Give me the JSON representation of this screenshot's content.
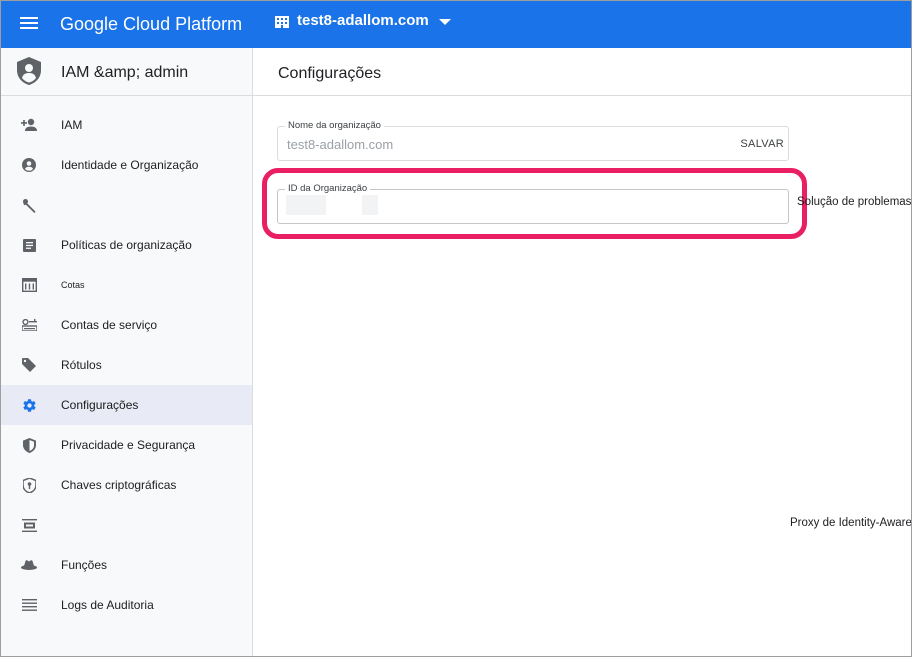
{
  "topbar": {
    "brand": "Google Cloud Platform",
    "project_name": "test8-adallom.com",
    "color": "#1a73e8"
  },
  "sidebar": {
    "title": "IAM &amp; admin",
    "items": [
      {
        "label": "IAM",
        "icon": "person-add-icon"
      },
      {
        "label": "Identidade e Organização",
        "icon": "account-circle-icon"
      },
      {
        "label": "",
        "icon": "wrench-icon"
      },
      {
        "label": "Políticas de organização",
        "icon": "list-document-icon"
      },
      {
        "label": "Cotas",
        "icon": "quota-grid-icon"
      },
      {
        "label": "Contas de serviço",
        "icon": "service-account-icon"
      },
      {
        "label": "Rótulos",
        "icon": "tag-icon"
      },
      {
        "label": "Configurações",
        "icon": "gear-icon",
        "active": true
      },
      {
        "label": "Privacidade e Segurança",
        "icon": "shield-icon"
      },
      {
        "label": "Chaves criptográficas",
        "icon": "key-shield-icon"
      },
      {
        "label": "",
        "icon": "identity-proxy-icon"
      },
      {
        "label": "Funções",
        "icon": "roles-hat-icon"
      },
      {
        "label": "Logs de Auditoria",
        "icon": "audit-log-icon"
      }
    ]
  },
  "main": {
    "title": "Configurações",
    "org_name": {
      "label": "Nome da organização",
      "value": "test8-adallom.com",
      "save_label": "SALVAR"
    },
    "org_id": {
      "label": "ID da Organização",
      "value": ""
    },
    "troubleshoot_link": "Solução de problemas",
    "iap_link": "Proxy de Identity-Aware",
    "highlight_color": "#e91e63"
  }
}
